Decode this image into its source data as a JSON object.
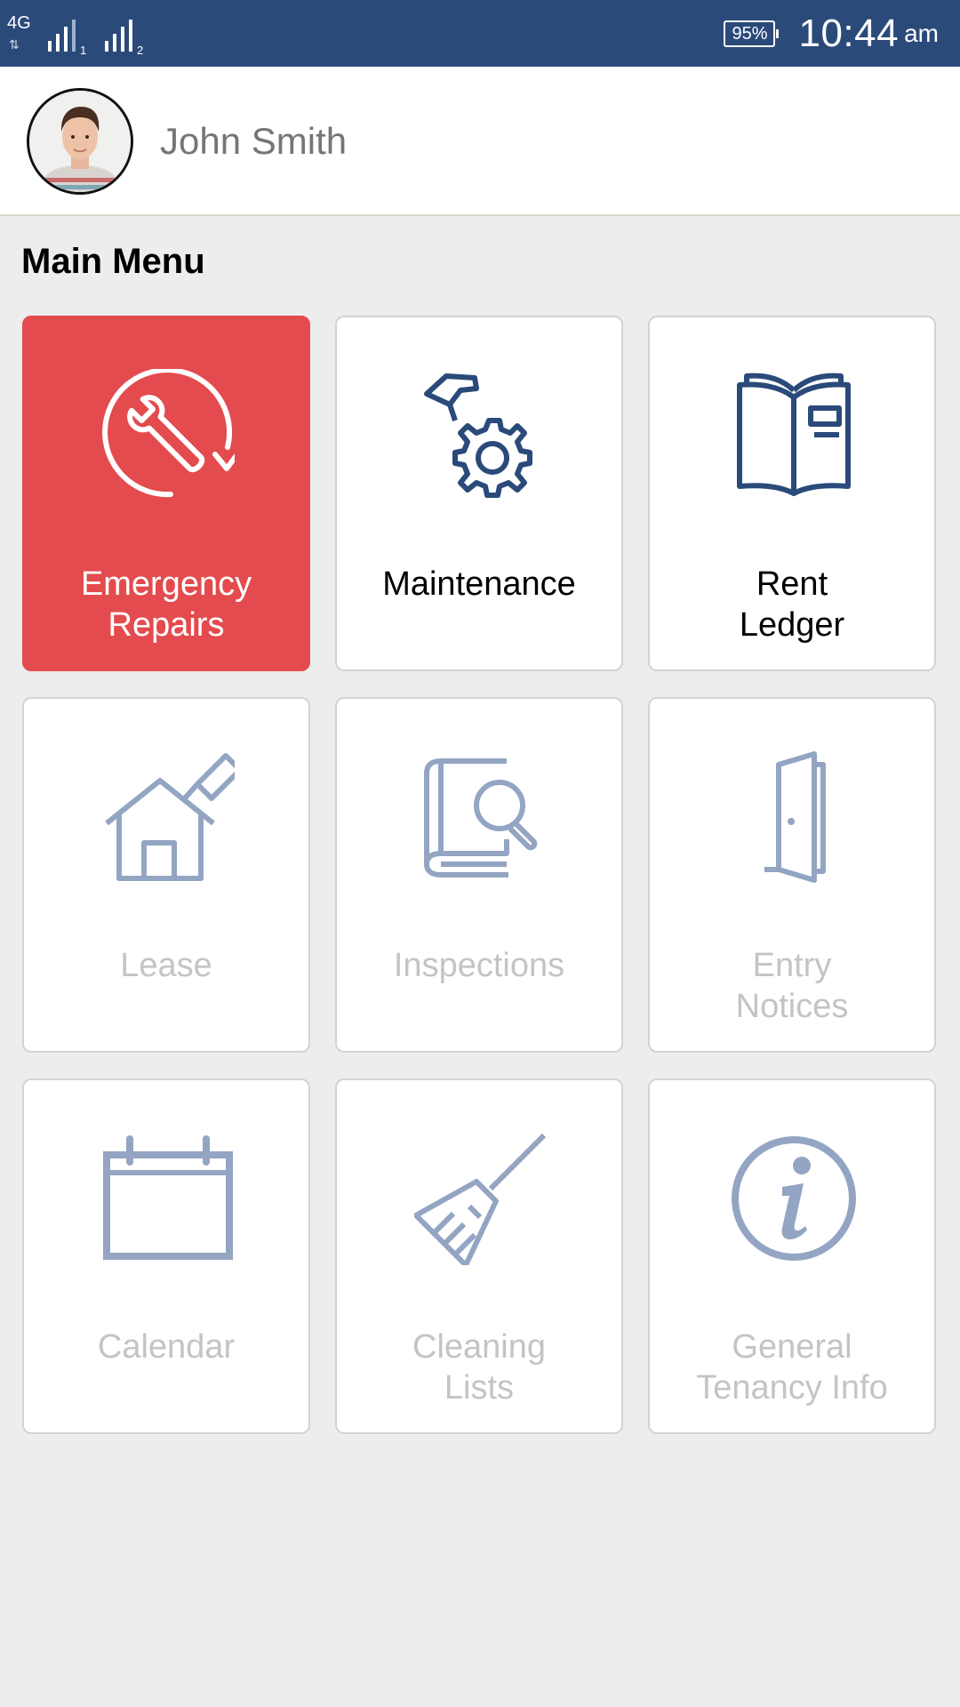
{
  "status_bar": {
    "network_type": "4G",
    "sim1_indicator": "1",
    "sim2_indicator": "2",
    "battery": "95%",
    "time": "10:44",
    "time_suffix": "am"
  },
  "profile": {
    "name": "John Smith"
  },
  "menu": {
    "title": "Main Menu",
    "items": [
      {
        "label": "Emergency\nRepairs",
        "icon": "wrench-refresh-icon",
        "state": "active"
      },
      {
        "label": "Maintenance",
        "icon": "hammer-gear-icon",
        "state": "enabled"
      },
      {
        "label": "Rent\nLedger",
        "icon": "open-book-icon",
        "state": "enabled"
      },
      {
        "label": "Lease",
        "icon": "house-tag-icon",
        "state": "disabled"
      },
      {
        "label": "Inspections",
        "icon": "book-magnifier-icon",
        "state": "disabled"
      },
      {
        "label": "Entry\nNotices",
        "icon": "door-icon",
        "state": "disabled"
      },
      {
        "label": "Calendar",
        "icon": "calendar-icon",
        "state": "disabled"
      },
      {
        "label": "Cleaning\nLists",
        "icon": "broom-icon",
        "state": "disabled"
      },
      {
        "label": "General\nTenancy Info",
        "icon": "info-icon",
        "state": "disabled"
      }
    ]
  },
  "colors": {
    "status_bar": "#2a4a7a",
    "active_tile": "#e34b4e",
    "icon_enabled": "#2a4a7a",
    "icon_disabled": "#93a5c2",
    "label_disabled": "#c4c4c4"
  }
}
